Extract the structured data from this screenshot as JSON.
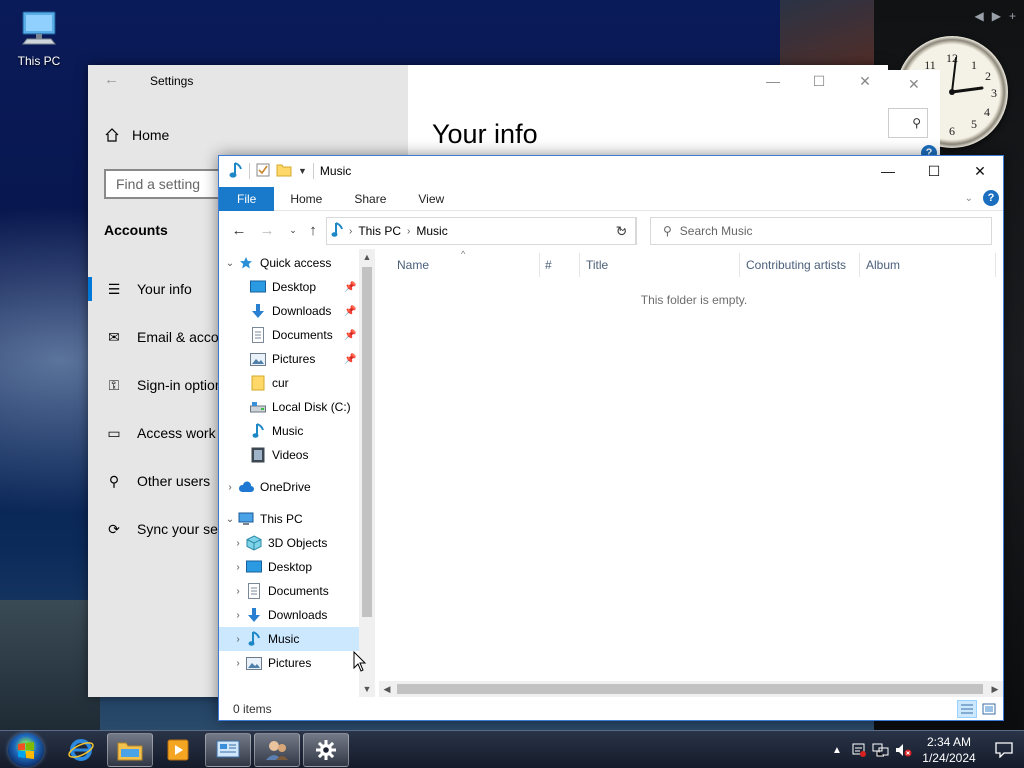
{
  "desktop": {
    "icons": [
      {
        "label": "This PC",
        "icon": "monitor-icon"
      }
    ]
  },
  "settings": {
    "title": "Settings",
    "home_label": "Home",
    "search_placeholder": "Find a setting",
    "section_title": "Accounts",
    "page_heading": "Your info",
    "nav": [
      {
        "label": "Your info",
        "icon": "contact-card-icon",
        "active": true
      },
      {
        "label": "Email & accou",
        "icon": "mail-icon"
      },
      {
        "label": "Sign-in option",
        "icon": "key-icon"
      },
      {
        "label": "Access work o",
        "icon": "briefcase-icon"
      },
      {
        "label": "Other users",
        "icon": "person-add-icon"
      },
      {
        "label": "Sync your set",
        "icon": "sync-icon"
      }
    ]
  },
  "explorer": {
    "title": "Music",
    "ribbon_tabs": [
      "File",
      "Home",
      "Share",
      "View"
    ],
    "address": {
      "crumbs": [
        "This PC",
        "Music"
      ]
    },
    "search_placeholder": "Search Music",
    "columns": [
      "Name",
      "#",
      "Title",
      "Contributing artists",
      "Album"
    ],
    "empty_message": "This folder is empty.",
    "status": "0 items",
    "nav_tree": [
      {
        "label": "Quick access",
        "icon": "star-icon",
        "level": 0,
        "expander": "expanded"
      },
      {
        "label": "Desktop",
        "icon": "desktop-folder-icon",
        "level": 1,
        "pinned": true
      },
      {
        "label": "Downloads",
        "icon": "download-arrow-icon",
        "level": 1,
        "pinned": true
      },
      {
        "label": "Documents",
        "icon": "document-icon",
        "level": 1,
        "pinned": true
      },
      {
        "label": "Pictures",
        "icon": "picture-icon",
        "level": 1,
        "pinned": true
      },
      {
        "label": "cur",
        "icon": "folder-icon",
        "level": 1
      },
      {
        "label": "Local Disk (C:)",
        "icon": "drive-icon",
        "level": 1
      },
      {
        "label": "Music",
        "icon": "music-note-icon",
        "level": 1
      },
      {
        "label": "Videos",
        "icon": "film-icon",
        "level": 1
      },
      {
        "label": "OneDrive",
        "icon": "cloud-icon",
        "level": 0,
        "expander": "collapsed"
      },
      {
        "label": "This PC",
        "icon": "monitor-icon",
        "level": 0,
        "expander": "expanded"
      },
      {
        "label": "3D Objects",
        "icon": "cube-icon",
        "level": 1,
        "expander": "collapsed"
      },
      {
        "label": "Desktop",
        "icon": "desktop-folder-icon",
        "level": 1,
        "expander": "collapsed"
      },
      {
        "label": "Documents",
        "icon": "document-icon",
        "level": 1,
        "expander": "collapsed"
      },
      {
        "label": "Downloads",
        "icon": "download-arrow-icon",
        "level": 1,
        "expander": "collapsed"
      },
      {
        "label": "Music",
        "icon": "music-note-icon",
        "level": 1,
        "expander": "collapsed",
        "selected": true
      },
      {
        "label": "Pictures",
        "icon": "picture-icon",
        "level": 1,
        "expander": "collapsed"
      }
    ]
  },
  "taskbar": {
    "pinned": [
      {
        "name": "internet-explorer",
        "icon": "ie-icon"
      },
      {
        "name": "file-explorer",
        "icon": "folder-icon",
        "active": true
      },
      {
        "name": "media-player",
        "icon": "media-player-icon"
      },
      {
        "name": "control-panel",
        "icon": "control-panel-icon"
      },
      {
        "name": "users",
        "icon": "users-icon"
      },
      {
        "name": "settings",
        "icon": "gear-icon",
        "active": true
      }
    ],
    "time": "2:34 AM",
    "date": "1/24/2024"
  },
  "colors": {
    "accent": "#0078d7",
    "file_tab": "#1979ca",
    "selected_row": "#cce8ff",
    "taskbar": "#1b2333"
  }
}
